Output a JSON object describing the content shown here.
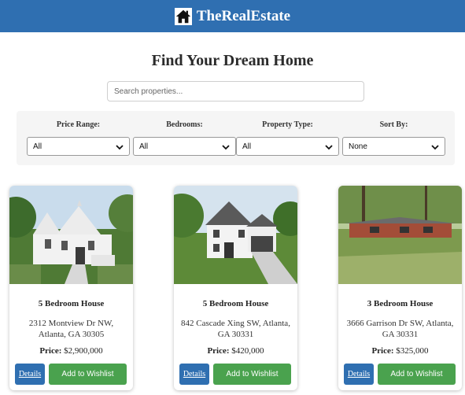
{
  "header": {
    "brand": "TheRealEstate",
    "logo_icon": "house-icon"
  },
  "page": {
    "title": "Find Your Dream Home"
  },
  "search": {
    "placeholder": "Search properties..."
  },
  "filters": [
    {
      "label": "Price Range:",
      "value": "All"
    },
    {
      "label": "Bedrooms:",
      "value": "All"
    },
    {
      "label": "Property Type:",
      "value": "All"
    },
    {
      "label": "Sort By:",
      "value": "None"
    }
  ],
  "listings": [
    {
      "title": "5 Bedroom House",
      "address": "2312 Montview Dr NW, Atlanta, GA 30305",
      "price_label": "Price:",
      "price": "$2,900,000",
      "details_label": "Details",
      "wishlist_label": "Add to Wishlist"
    },
    {
      "title": "5 Bedroom House",
      "address": "842 Cascade Xing SW, Atlanta, GA 30331",
      "price_label": "Price:",
      "price": "$420,000",
      "details_label": "Details",
      "wishlist_label": "Add to Wishlist"
    },
    {
      "title": "3 Bedroom House",
      "address": "3666 Garrison Dr SW, Atlanta, GA 30331",
      "price_label": "Price:",
      "price": "$325,000",
      "details_label": "Details",
      "wishlist_label": "Add to Wishlist"
    }
  ],
  "colors": {
    "header_bg": "#2f6fb1",
    "details_button": "#2f6fb1",
    "wishlist_button": "#4aa24e"
  }
}
